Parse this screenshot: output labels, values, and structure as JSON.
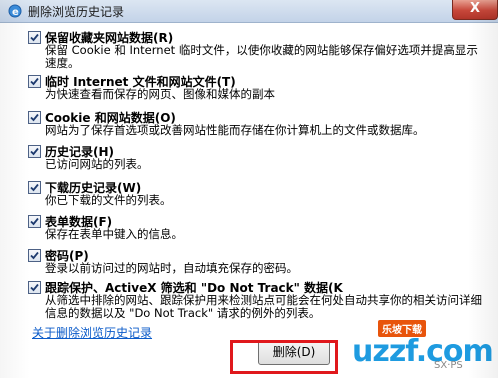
{
  "window": {
    "title": "删除浏览历史记录",
    "close_glyph": "X"
  },
  "options": [
    {
      "title": "保留收藏夹网站数据(R)",
      "desc": "保留 Cookie 和 Internet 临时文件，以使你收藏的网站能够保存偏好选项并提高显示速度。",
      "checked": true
    },
    {
      "title": "临时 Internet 文件和网站文件(T)",
      "desc": "为快速查看而保存的网页、图像和媒体的副本",
      "checked": true
    },
    {
      "title": "Cookie 和网站数据(O)",
      "desc": "网站为了保存首选项或改善网站性能而存储在你计算机上的文件或数据库。",
      "checked": true
    },
    {
      "title": "历史记录(H)",
      "desc": "已访问网站的列表。",
      "checked": true
    },
    {
      "title": "下载历史记录(W)",
      "desc": "你已下载的文件的列表。",
      "checked": true
    },
    {
      "title": "表单数据(F)",
      "desc": "保存在表单中键入的信息。",
      "checked": true
    },
    {
      "title": "密码(P)",
      "desc": "登录以前访问过的网站时，自动填充保存的密码。",
      "checked": true
    },
    {
      "title": "跟踪保护、ActiveX 筛选和 \"Do Not Track\" 数据(K",
      "desc": "从筛选中排除的网站、跟踪保护用来检测站点可能会在何处自动共享你的相关访问详细信息的数据以及 \"Do Not Track\" 请求的例外的列表。",
      "checked": true
    }
  ],
  "footer": {
    "link": "关于删除浏览历史记录",
    "delete_button": "删除(D)"
  },
  "watermark": {
    "badge": "乐坡下载",
    "logo": "uzzf.com",
    "tail": "SX·PS"
  },
  "colors": {
    "link": "#0b5bc9",
    "highlight": "#e0181c",
    "titlebar": "#c3d3e8"
  }
}
